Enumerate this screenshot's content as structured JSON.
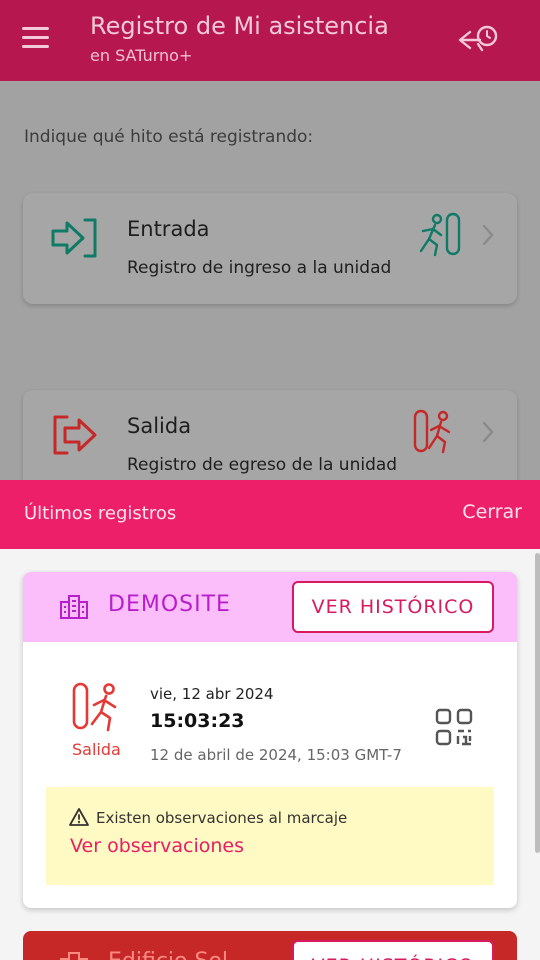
{
  "header": {
    "title": "Registro de Mi asistencia",
    "subtitle": "en SATurno+",
    "menu_icon": "hamburger-menu-icon",
    "logout_icon": "exit-clock-icon"
  },
  "main": {
    "prompt": "Indique qué hito está registrando:",
    "options": [
      {
        "title": "Entrada",
        "description": "Registro de ingreso a la unidad",
        "icon": "login-arrow-icon",
        "figure": "person-entering-icon",
        "color": "#0f7a66"
      },
      {
        "title": "Salida",
        "description": "Registro de egreso de la unidad",
        "icon": "logout-arrow-icon",
        "figure": "person-exiting-icon",
        "color": "#c62828"
      }
    ]
  },
  "sheet": {
    "title": "Últimos registros",
    "close_label": "Cerrar",
    "sites": [
      {
        "name": "DEMOSITE",
        "history_label": "VER HISTÓRICO",
        "record": {
          "type": "Salida",
          "date": "vie, 12 abr 2024",
          "time": "15:03:23",
          "full": "12 de abril de 2024, 15:03 GMT-7"
        },
        "observation": {
          "text": "Existen observaciones al marcaje",
          "link": "Ver observaciones"
        }
      },
      {
        "name": "Edificio Sol",
        "history_label": "VER HISTÓRICO"
      }
    ]
  },
  "colors": {
    "appbar": "#b7174f",
    "sheet_bar": "#ec1f68",
    "site_header": "#fcbdfb",
    "accent": "#d81b60"
  }
}
